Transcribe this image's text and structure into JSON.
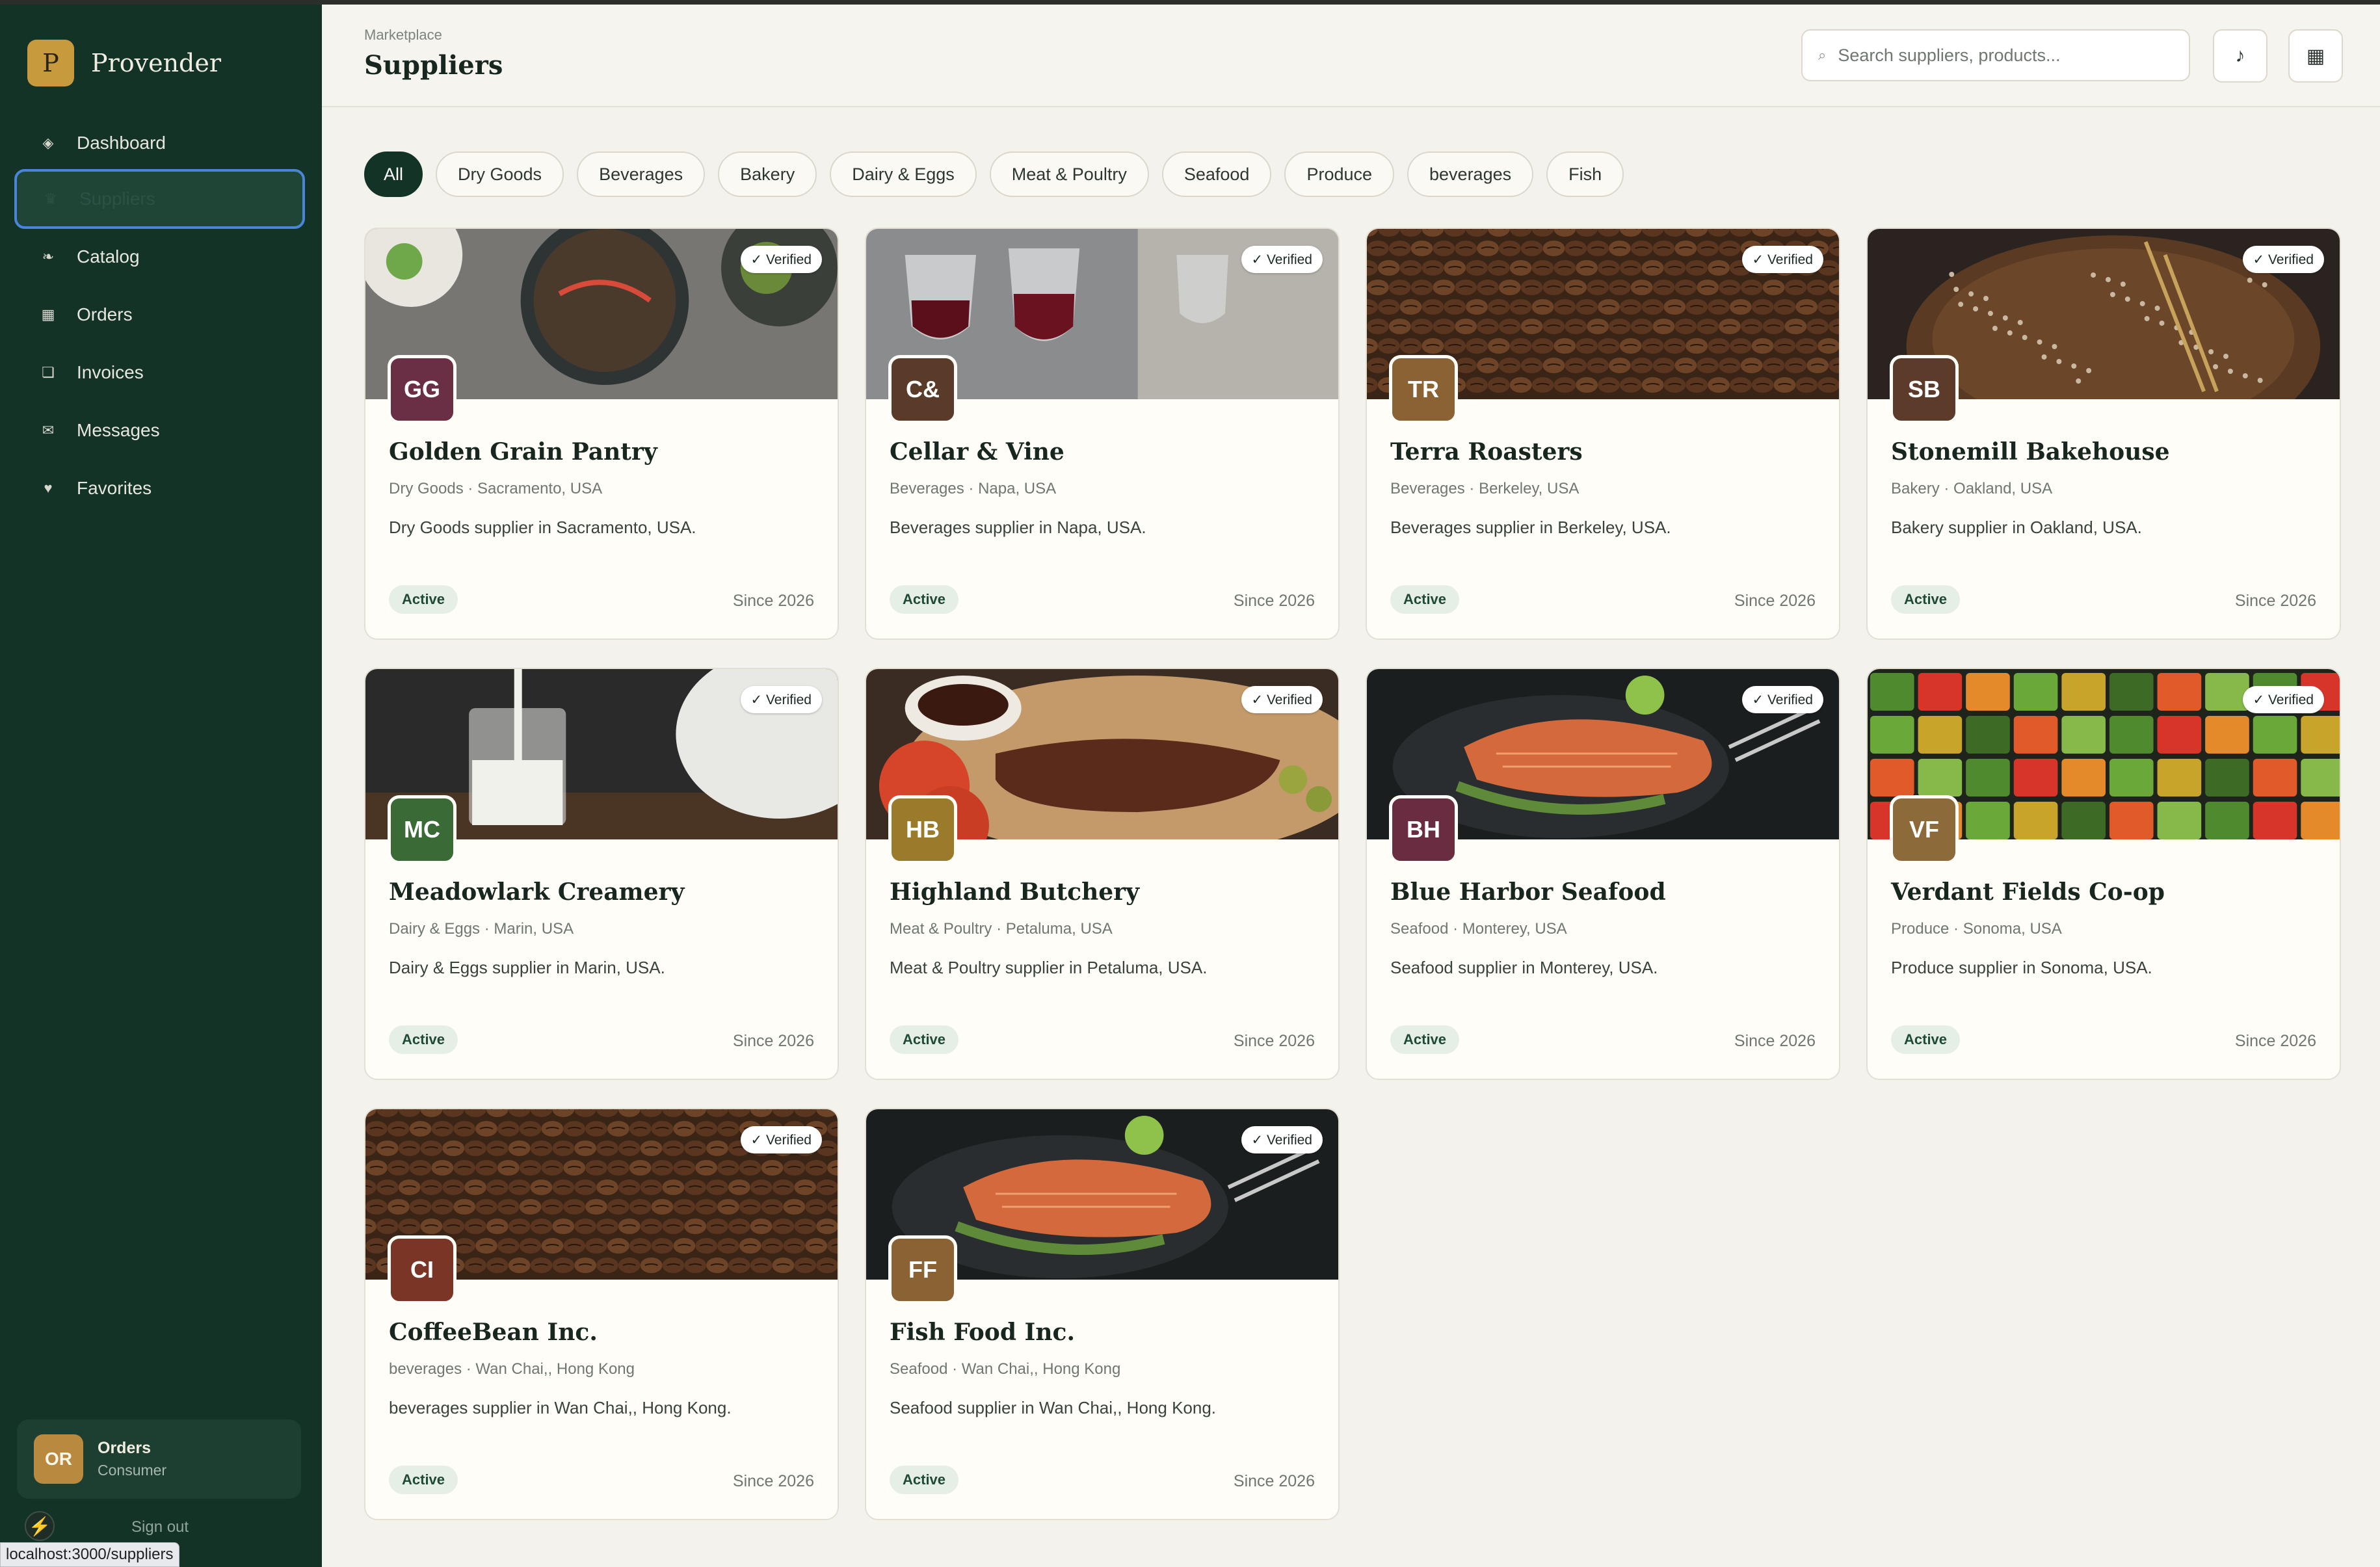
{
  "app": {
    "name": "Provender",
    "logo_letter": "P"
  },
  "sidebar": {
    "items": [
      {
        "label": "Dashboard",
        "icon": "◈",
        "icon_name": "dashboard-icon",
        "active": false
      },
      {
        "label": "Suppliers",
        "icon": "♛",
        "icon_name": "suppliers-icon",
        "active": true
      },
      {
        "label": "Catalog",
        "icon": "❧",
        "icon_name": "catalog-icon",
        "active": false
      },
      {
        "label": "Orders",
        "icon": "▦",
        "icon_name": "orders-icon",
        "active": false
      },
      {
        "label": "Invoices",
        "icon": "❏",
        "icon_name": "invoices-icon",
        "active": false
      },
      {
        "label": "Messages",
        "icon": "✉",
        "icon_name": "messages-icon",
        "active": false
      },
      {
        "label": "Favorites",
        "icon": "♥",
        "icon_name": "favorites-icon",
        "active": false
      }
    ],
    "user": {
      "initials": "OR",
      "name": "Orders",
      "role": "Consumer"
    },
    "bolt_icon": "⚡",
    "signout_label": "Sign out"
  },
  "status_bar_url": "localhost:3000/suppliers",
  "header": {
    "breadcrumb": "Marketplace",
    "title": "Suppliers",
    "search_placeholder": "Search suppliers, products...",
    "search_icon": "⌕",
    "music_icon": "♪",
    "grid_icon": "▦"
  },
  "filters": [
    "All",
    "Dry Goods",
    "Beverages",
    "Bakery",
    "Dairy & Eggs",
    "Meat & Poultry",
    "Seafood",
    "Produce",
    "beverages",
    "Fish"
  ],
  "active_filter": "All",
  "verified_label": "✓ Verified",
  "suppliers": [
    {
      "initials": "GG",
      "name": "Golden Grain Pantry",
      "meta": "Dry Goods · Sacramento, USA",
      "description": "Dry Goods supplier in Sacramento, USA.",
      "status": "Active",
      "since": "Since 2026",
      "color": "#6b2f45",
      "image": "food"
    },
    {
      "initials": "C&",
      "name": "Cellar & Vine",
      "meta": "Beverages · Napa, USA",
      "description": "Beverages supplier in Napa, USA.",
      "status": "Active",
      "since": "Since 2026",
      "color": "#5a3a28",
      "image": "wine"
    },
    {
      "initials": "TR",
      "name": "Terra Roasters",
      "meta": "Beverages · Berkeley, USA",
      "description": "Beverages supplier in Berkeley, USA.",
      "status": "Active",
      "since": "Since 2026",
      "color": "#8a6233",
      "image": "coffee"
    },
    {
      "initials": "SB",
      "name": "Stonemill Bakehouse",
      "meta": "Bakery · Oakland, USA",
      "description": "Bakery supplier in Oakland, USA.",
      "status": "Active",
      "since": "Since 2026",
      "color": "#5c3b2b",
      "image": "bread"
    },
    {
      "initials": "MC",
      "name": "Meadowlark Creamery",
      "meta": "Dairy & Eggs · Marin, USA",
      "description": "Dairy & Eggs supplier in Marin, USA.",
      "status": "Active",
      "since": "Since 2026",
      "color": "#3a6a36",
      "image": "milk"
    },
    {
      "initials": "HB",
      "name": "Highland Butchery",
      "meta": "Meat & Poultry · Petaluma, USA",
      "description": "Meat & Poultry supplier in Petaluma, USA.",
      "status": "Active",
      "since": "Since 2026",
      "color": "#9a7a2b",
      "image": "meat"
    },
    {
      "initials": "BH",
      "name": "Blue Harbor Seafood",
      "meta": "Seafood · Monterey, USA",
      "description": "Seafood supplier in Monterey, USA.",
      "status": "Active",
      "since": "Since 2026",
      "color": "#6a2c40",
      "image": "salmon"
    },
    {
      "initials": "VF",
      "name": "Verdant Fields Co-op",
      "meta": "Produce · Sonoma, USA",
      "description": "Produce supplier in Sonoma, USA.",
      "status": "Active",
      "since": "Since 2026",
      "color": "#8c6a3a",
      "image": "produce"
    },
    {
      "initials": "CI",
      "name": "CoffeeBean Inc.",
      "meta": "beverages · Wan Chai,, Hong Kong",
      "description": "beverages supplier in Wan Chai,, Hong Kong.",
      "status": "Active",
      "since": "Since 2026",
      "color": "#7a3526",
      "image": "coffee"
    },
    {
      "initials": "FF",
      "name": "Fish Food Inc.",
      "meta": "Seafood · Wan Chai,, Hong Kong",
      "description": "Seafood supplier in Wan Chai,, Hong Kong.",
      "status": "Active",
      "since": "Since 2026",
      "color": "#8a6233",
      "image": "salmon"
    }
  ]
}
